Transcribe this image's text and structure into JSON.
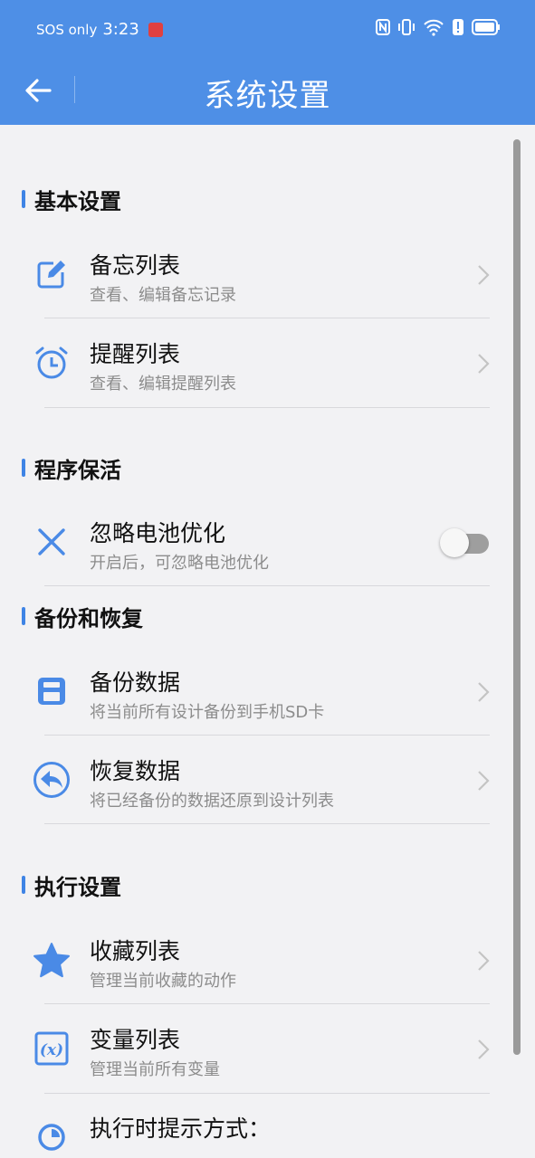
{
  "status_bar": {
    "network": "SOS only",
    "time": "3:23",
    "icons": [
      "nfc-icon",
      "vibrate-icon",
      "wifi-icon",
      "alert-icon",
      "battery-icon"
    ]
  },
  "header": {
    "title": "系统设置",
    "back_icon": "arrow-left-icon",
    "background": "#4e8fe6"
  },
  "sections": [
    {
      "title": "基本设置",
      "items": [
        {
          "title": "备忘列表",
          "subtitle": "查看、编辑备忘记录",
          "icon": "edit-note-icon",
          "control": "chevron"
        },
        {
          "title": "提醒列表",
          "subtitle": "查看、编辑提醒列表",
          "icon": "alarm-clock-icon",
          "control": "chevron"
        }
      ]
    },
    {
      "title": "程序保活",
      "items": [
        {
          "title": "忽略电池优化",
          "subtitle": "开启后，可忽略电池优化",
          "icon": "close-x-icon",
          "control": "toggle",
          "toggle_on": false
        }
      ]
    },
    {
      "title": "备份和恢复",
      "items": [
        {
          "title": "备份数据",
          "subtitle": "将当前所有设计备份到手机SD卡",
          "icon": "save-disk-icon",
          "control": "chevron"
        },
        {
          "title": "恢复数据",
          "subtitle": "将已经备份的数据还原到设计列表",
          "icon": "restore-back-icon",
          "control": "chevron"
        }
      ]
    },
    {
      "title": "执行设置",
      "items": [
        {
          "title": "收藏列表",
          "subtitle": "管理当前收藏的动作",
          "icon": "star-icon",
          "control": "chevron"
        },
        {
          "title": "变量列表",
          "subtitle": "管理当前所有变量",
          "icon": "variable-x-icon",
          "control": "chevron"
        },
        {
          "title": "执行时提示方式：",
          "icon": "progress-ring-icon"
        }
      ]
    }
  ],
  "colors": {
    "accent": "#3f84e5",
    "icon": "#4a8ae6",
    "background": "#f2f2f4"
  }
}
